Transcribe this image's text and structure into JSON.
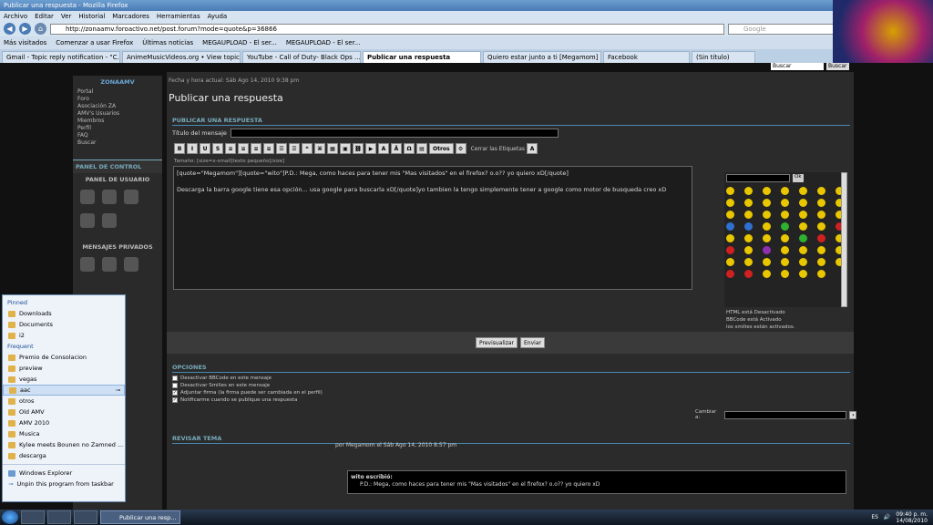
{
  "window": {
    "title": "Publicar una respuesta - Mozilla Firefox"
  },
  "menu": [
    "Archivo",
    "Editar",
    "Ver",
    "Historial",
    "Marcadores",
    "Herramientas",
    "Ayuda"
  ],
  "nav": {
    "url": "http://zonaamv.foroactivo.net/post.forum?mode=quote&p=36866",
    "search_placeholder": "Google"
  },
  "bookmarks": [
    "Más visitados",
    "Comenzar a usar Firefox",
    "Últimas noticias",
    "MEGAUPLOAD - El ser...",
    "MEGAUPLOAD - El ser..."
  ],
  "tabs": [
    "Gmail - Topic reply notification - \"C...",
    "AnimeMusicVideos.org • View topic...",
    "YouTube - Call of Duty- Black Ops ...",
    "Publicar una respuesta",
    "Quiero estar junto a ti [Megamom]",
    "Facebook",
    "(Sin título)"
  ],
  "site": {
    "search_placeholder": "Buscar",
    "search_button": "Buscar",
    "sidebar_title": "ZONAAMV",
    "links": [
      "Portal",
      "Foro",
      "Asociación ZA",
      "AMV's Usuarios",
      "Miembros",
      "Perfil",
      "FAQ",
      "Buscar"
    ],
    "panel_title": "PANEL DE CONTROL",
    "user_panel": "PANEL DE USUARIO",
    "private_msgs": "MENSAJES PRIVADOS",
    "date_line": "Fecha y hora actual: Sáb Ago 14, 2010 9:38 pm",
    "page_title": "Publicar una respuesta",
    "block_title": "PUBLICAR UNA RESPUESTA",
    "subject_label": "Título del mensaje",
    "toolbar": [
      "B",
      "I",
      "U",
      "S",
      "Otros",
      "Cerrar las Etiquetas"
    ],
    "size_hint": "Tamaño: [size=x-small]texto pequeño[/size]",
    "editor_line1": "[quote=\"Megamom\"][quote=\"wito\"]P.D.: Mega, como haces para tener mis \"Mas visitados\" en el firefox? o.o?? yo quiero xD[/quote]",
    "editor_line2": "Descarga la barra google tiene esa opción... usa google para buscarla xD[/quote]yo tambien la tengo simplemente tener a google como motor de busqueda creo xD",
    "ok": "Ok",
    "status": [
      "HTML está Desactivado",
      "BBCode está Activado",
      "los smilies están activados."
    ],
    "preview_button": "Previsualizar",
    "send_button": "Enviar",
    "options_title": "OPCIONES",
    "options": [
      {
        "label": "Desactivar BBCode en este mensaje",
        "checked": ""
      },
      {
        "label": "Desactivar Smilies en este mensaje",
        "checked": ""
      },
      {
        "label": "Adjuntar firma (la firma puede ser cambiada en el perfil)",
        "checked": "✓"
      },
      {
        "label": "Notificarme cuando se publique una respuesta",
        "checked": "✓"
      }
    ],
    "change_to": "Cambiar a:",
    "review_title": "REVISAR TEMA",
    "post_by": "por Megamom el Sáb Ago 14, 2010 8:57 pm",
    "quote_author": "wito escribió:",
    "quote_text": "P.D.: Mega, como haces para tener mis \"Mas visitados\" en el firefox? o.o?? yo quiero xD"
  },
  "jumplist": {
    "pinned_title": "Pinned",
    "pinned": [
      "Downloads",
      "Documents",
      "i2"
    ],
    "frequent_title": "Frequent",
    "frequent": [
      "Premio de Consolacion",
      "preview",
      "vegas",
      "aac",
      "otros",
      "Old AMV",
      "AMV 2010",
      "Musica",
      "Kylee meets Bounen no Zamned ...",
      "descarga"
    ],
    "actions": [
      "Windows Explorer",
      "Unpin this program from taskbar"
    ]
  },
  "taskbar": {
    "task": "Publicar una resp...",
    "lang": "ES",
    "time": "09:40 p. m.",
    "date": "14/08/2010"
  }
}
